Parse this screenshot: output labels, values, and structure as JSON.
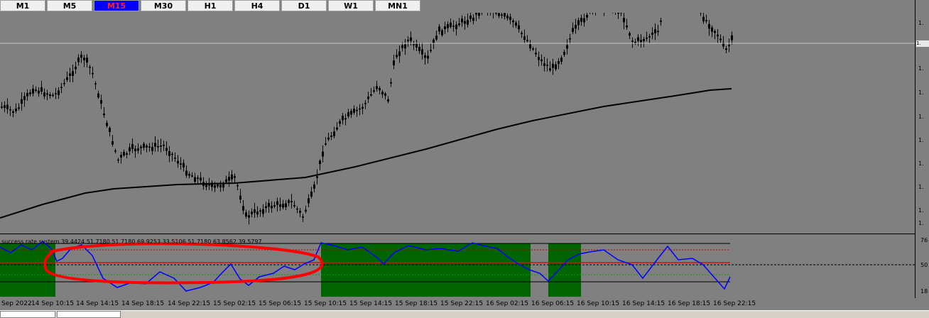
{
  "timeframes": [
    "M1",
    "M5",
    "M15",
    "M30",
    "H1",
    "H4",
    "D1",
    "W1",
    "MN1"
  ],
  "active_timeframe": "M15",
  "indicator": {
    "label": "success rate system 39.4424 51.7180 51.7180 69.9253 33.5106 51.7180 63.8562 39.5797",
    "scale": [
      "76",
      "50",
      "18"
    ]
  },
  "price_scale": [
    "1.",
    "1.",
    "1.",
    "1.",
    "1.",
    "1.",
    "1.",
    "1.",
    "1."
  ],
  "current_price_label": "1.",
  "time_labels": [
    "Sep 2022",
    "14 Sep 10:15",
    "14 Sep 14:15",
    "14 Sep 18:15",
    "14 Sep 22:15",
    "15 Sep 02:15",
    "15 Sep 06:15",
    "15 Sep 10:15",
    "15 Sep 14:15",
    "15 Sep 18:15",
    "15 Sep 22:15",
    "16 Sep 02:15",
    "16 Sep 06:15",
    "16 Sep 10:15",
    "16 Sep 14:15",
    "16 Sep 18:15",
    "16 Sep 22:15"
  ],
  "colors": {
    "background": "#808080",
    "candle": "#000000",
    "moving_average": "#000000",
    "oscillator": "#0000ff",
    "zone_fill": "#006400",
    "highlight_circle": "#ff0000",
    "current_price_line": "#c8c8c8"
  },
  "bottom_tabs": [
    "",
    ""
  ]
}
